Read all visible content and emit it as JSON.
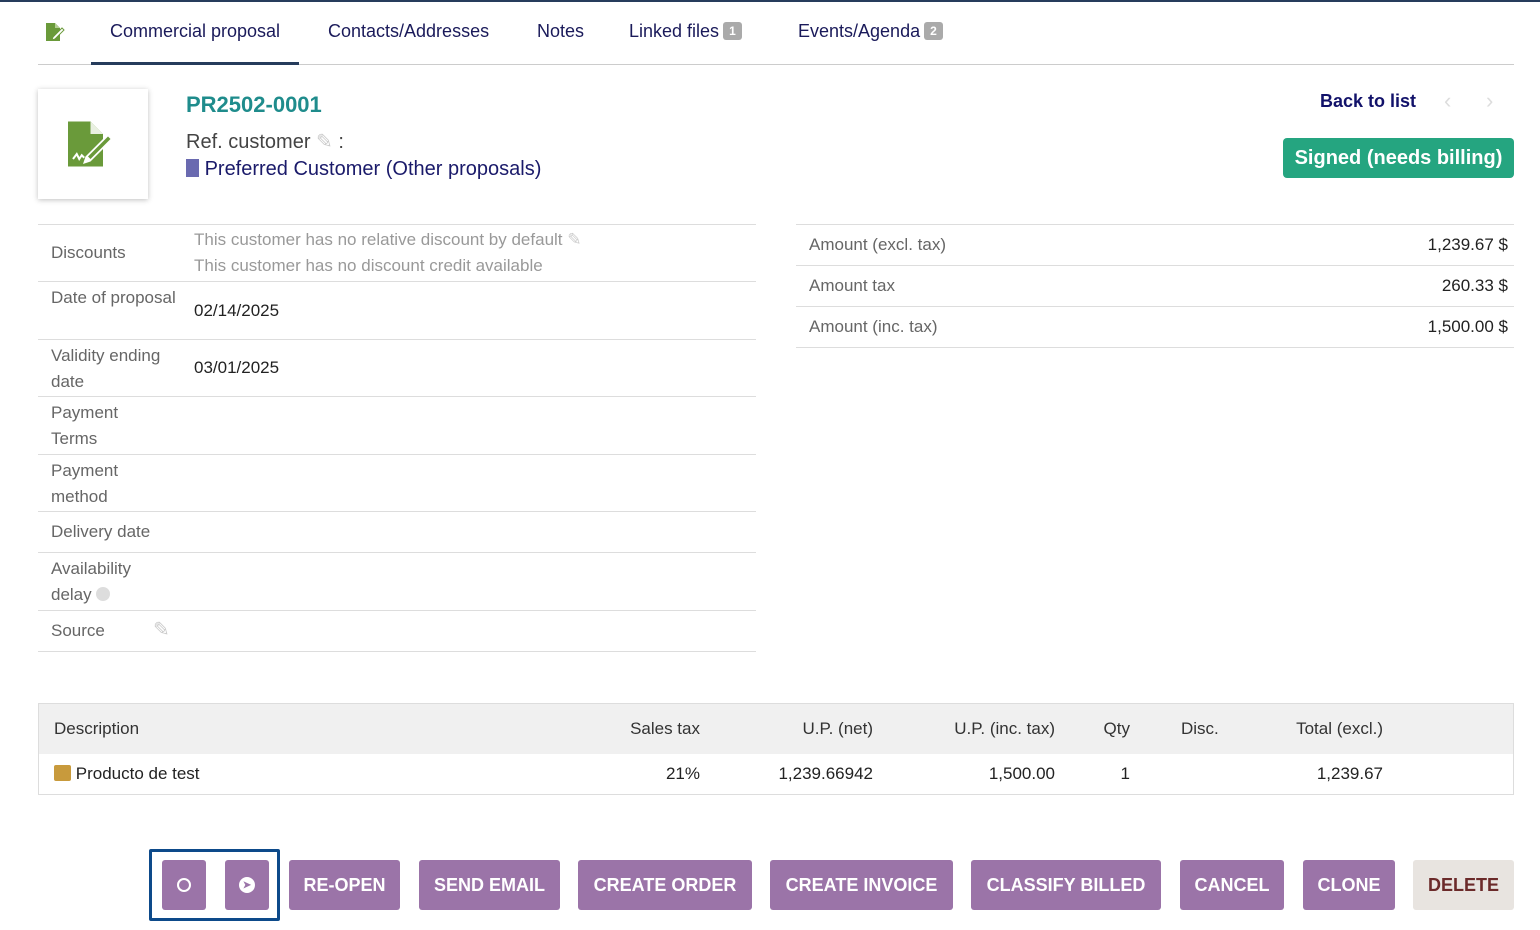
{
  "tabs": [
    {
      "label": "Commercial proposal"
    },
    {
      "label": "Contacts/Addresses"
    },
    {
      "label": "Notes"
    },
    {
      "label": "Linked files",
      "badge": "1"
    },
    {
      "label": "Events/Agenda",
      "badge": "2"
    }
  ],
  "header": {
    "ref": "PR2502-0001",
    "ref_customer_label": "Ref. customer",
    "colon": ":",
    "customer": "Preferred Customer",
    "other_proposals": "(Other proposals)",
    "back_to_list": "Back to list",
    "status": "Signed (needs billing)",
    "status_color": "#25a580"
  },
  "fields": [
    {
      "label": "Discounts",
      "value1": "This customer has no relative discount by default",
      "value2": "This customer has no discount credit available"
    },
    {
      "label": "Date of proposal",
      "value": "02/14/2025"
    },
    {
      "label": "Validity ending date",
      "value": "03/01/2025"
    },
    {
      "label": "Payment Terms",
      "value": ""
    },
    {
      "label": "Payment method",
      "value": ""
    },
    {
      "label": "Delivery date",
      "value": ""
    },
    {
      "label": "Availability delay",
      "value": ""
    },
    {
      "label": "Source",
      "value": ""
    }
  ],
  "amounts": [
    {
      "label": "Amount (excl. tax)",
      "value": "1,239.67 $"
    },
    {
      "label": "Amount tax",
      "value": "260.33 $"
    },
    {
      "label": "Amount (inc. tax)",
      "value": "1,500.00 $"
    }
  ],
  "lines": {
    "headers": {
      "description": "Description",
      "tax": "Sales tax",
      "up_net": "U.P. (net)",
      "up_inc": "U.P. (inc. tax)",
      "qty": "Qty",
      "disc": "Disc.",
      "total": "Total (excl.)"
    },
    "rows": [
      {
        "description": "Producto de test",
        "tax": "21%",
        "up_net": "1,239.66942",
        "up_inc": "1,500.00",
        "qty": "1",
        "disc": "",
        "total": "1,239.67"
      }
    ]
  },
  "actions": {
    "reopen": "RE-OPEN",
    "send_email": "SEND EMAIL",
    "create_order": "CREATE ORDER",
    "create_invoice": "CREATE INVOICE",
    "classify_billed": "CLASSIFY BILLED",
    "cancel": "CANCEL",
    "clone": "CLONE",
    "delete": "DELETE"
  },
  "colors": {
    "button": "#9b74a8",
    "delete_bg": "#e8e4e0",
    "delete_text": "#6b2a2a",
    "accent": "#263c5c"
  }
}
